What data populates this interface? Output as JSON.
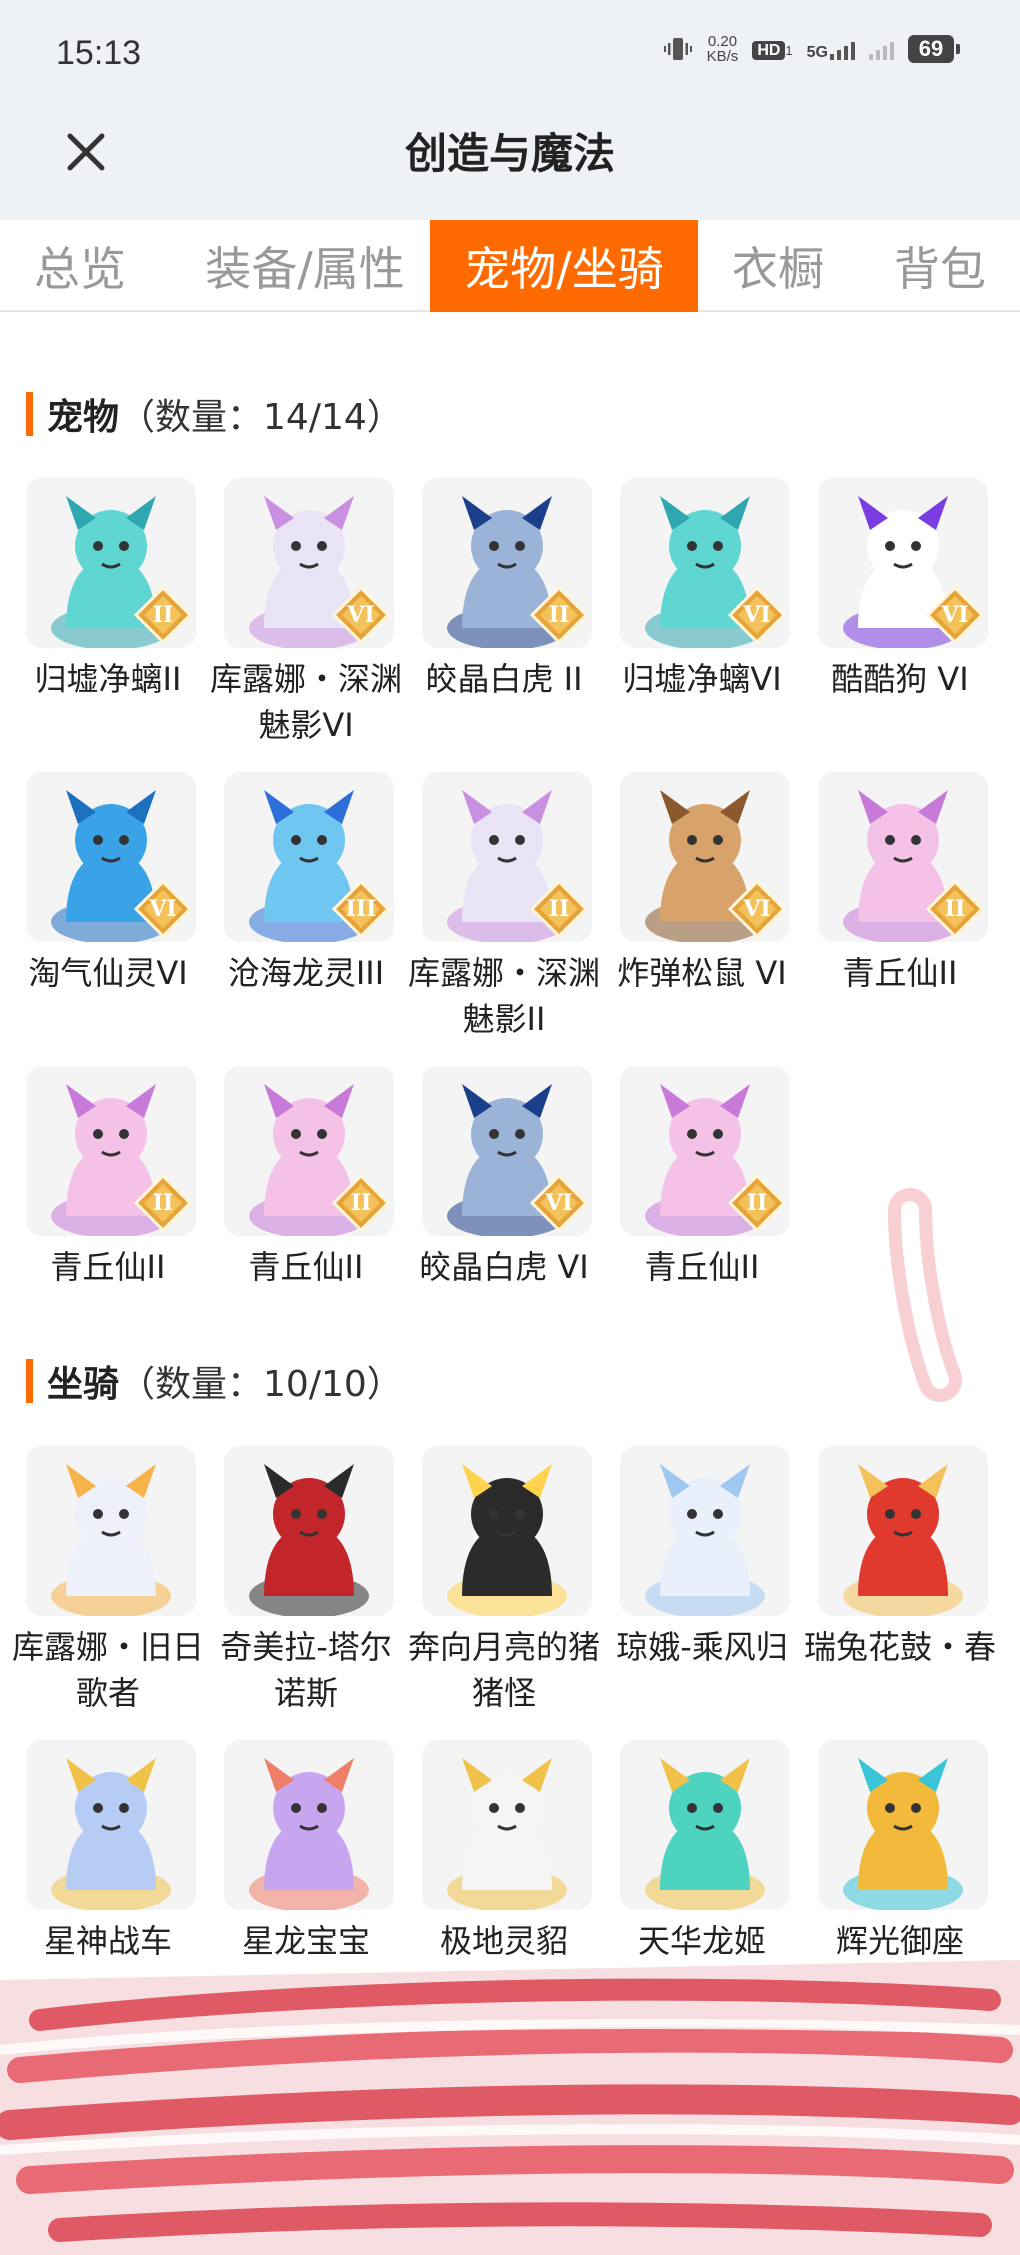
{
  "status_bar": {
    "time": "15:13",
    "net_speed_value": "0.20",
    "net_speed_unit": "KB/s",
    "hd_label": "HD",
    "hd_sub": "1",
    "network_label": "5G",
    "battery": "69"
  },
  "header": {
    "title": "创造与魔法",
    "close_icon": "close-icon"
  },
  "tabs": [
    {
      "label": "总览",
      "active": false
    },
    {
      "label": "装备/属性",
      "active": false
    },
    {
      "label": "宠物/坐骑",
      "active": true
    },
    {
      "label": "衣橱",
      "active": false
    },
    {
      "label": "背包",
      "active": false
    }
  ],
  "pets_section": {
    "name": "宠物",
    "count": "（数量：14/14）",
    "items": [
      {
        "name": "归墟净螭II",
        "icon": "dragon-teal",
        "badge": "II"
      },
      {
        "name": "库露娜・深渊魅影VI",
        "icon": "girl-white",
        "badge": "VI"
      },
      {
        "name": "皎晶白虎 II",
        "icon": "tiger-blue",
        "badge": "II"
      },
      {
        "name": "归墟净螭VI",
        "icon": "dragon-teal",
        "badge": "VI"
      },
      {
        "name": "酷酷狗 VI",
        "icon": "dog-white-goggles",
        "badge": "VI"
      },
      {
        "name": "淘气仙灵VI",
        "icon": "dog-blue",
        "badge": "VI"
      },
      {
        "name": "沧海龙灵III",
        "icon": "dragon-boy-blue",
        "badge": "III"
      },
      {
        "name": "库露娜・深渊魅影II",
        "icon": "girl-white",
        "badge": "II"
      },
      {
        "name": "炸弹松鼠 VI",
        "icon": "squirrel",
        "badge": "VI"
      },
      {
        "name": "青丘仙II",
        "icon": "fox-girl-pink",
        "badge": "II"
      },
      {
        "name": "青丘仙II",
        "icon": "fox-girl-pink",
        "badge": "II"
      },
      {
        "name": "青丘仙II",
        "icon": "fox-girl-pink",
        "badge": "II"
      },
      {
        "name": "皎晶白虎 VI",
        "icon": "tiger-blue",
        "badge": "VI"
      },
      {
        "name": "青丘仙II",
        "icon": "fox-girl-pink",
        "badge": "II"
      }
    ]
  },
  "mounts_section": {
    "name": "坐骑",
    "count": "（数量：10/10）",
    "items": [
      {
        "name": "库露娜・旧日歌者",
        "icon": "girl-white-orbs"
      },
      {
        "name": "奇美拉-塔尔诺斯",
        "icon": "chimera-red"
      },
      {
        "name": "奔向月亮的猪猪怪",
        "icon": "pig-black"
      },
      {
        "name": "琼娥-乘风归",
        "icon": "fairy-white"
      },
      {
        "name": "瑞兔花鼓・春",
        "icon": "drum-red"
      },
      {
        "name": "星神战车",
        "icon": "horse-blue"
      },
      {
        "name": "星龙宝宝",
        "icon": "dragon-baby-purple"
      },
      {
        "name": "极地灵貂",
        "icon": "fox-white"
      },
      {
        "name": "天华龙姬",
        "icon": "dragon-girl-gold"
      },
      {
        "name": "辉光御座",
        "icon": "throne-gold"
      }
    ]
  }
}
